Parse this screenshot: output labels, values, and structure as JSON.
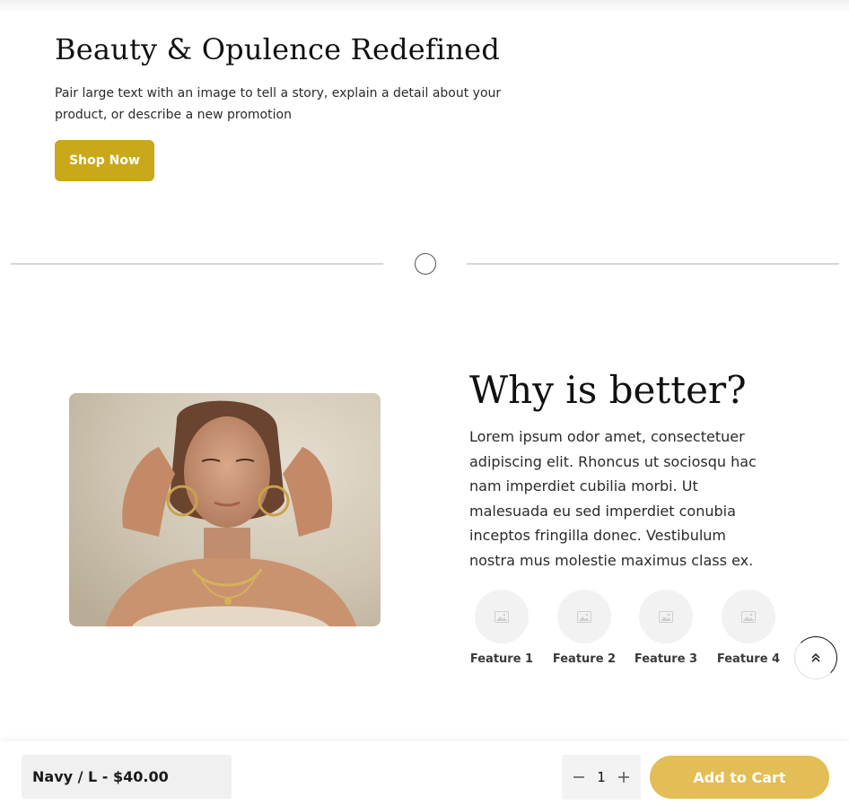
{
  "hero": {
    "title": "Beauty & Opulence Redefined",
    "text": "Pair large text with an image to tell a story, explain a detail about your product, or describe a new promotion",
    "button_label": "Shop Now"
  },
  "why": {
    "title": "Why is better?",
    "text": "Lorem ipsum odor amet, consectetuer adipiscing elit. Rhoncus ut sociosqu hac nam imperdiet cubilia morbi. Ut malesuada eu sed imperdiet conubia inceptos fringilla donec. Vestibulum nostra mus molestie maximus class ex."
  },
  "features": [
    {
      "label": "Feature 1",
      "icon": "image-placeholder-icon"
    },
    {
      "label": "Feature 2",
      "icon": "image-placeholder-icon"
    },
    {
      "label": "Feature 3",
      "icon": "image-placeholder-icon"
    },
    {
      "label": "Feature 4",
      "icon": "image-placeholder-icon"
    }
  ],
  "sticky_cart": {
    "variant": "Navy / L - $40.00",
    "quantity": "1",
    "add_label": "Add to Cart"
  },
  "colors": {
    "shop_button": "#c9a81a",
    "add_to_cart": "#e3bd55"
  }
}
